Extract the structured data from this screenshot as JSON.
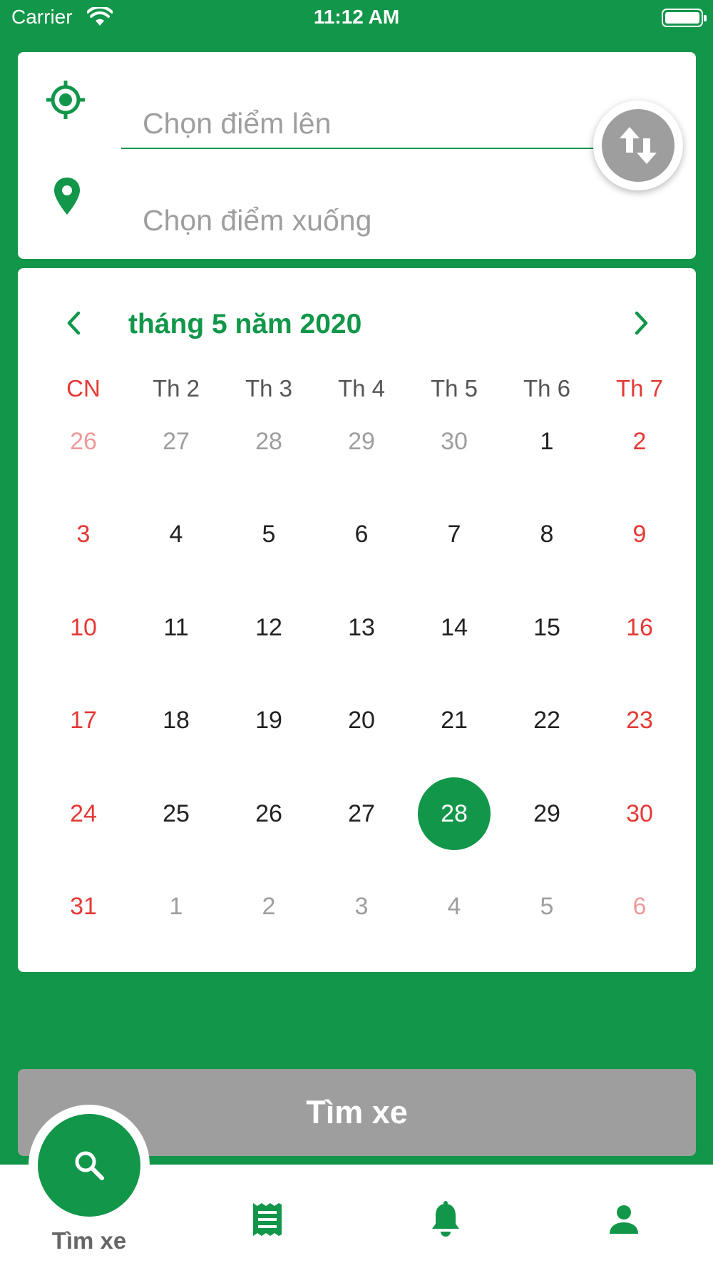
{
  "status_bar": {
    "carrier": "Carrier",
    "time": "11:12 AM"
  },
  "location": {
    "pickup_placeholder": "Chọn điểm lên",
    "dropoff_placeholder": "Chọn điểm xuống"
  },
  "calendar": {
    "month_title": "tháng 5 năm 2020",
    "weekdays": [
      "CN",
      "Th 2",
      "Th 3",
      "Th 4",
      "Th 5",
      "Th 6",
      "Th 7"
    ],
    "days": [
      {
        "label": "26",
        "type": "other"
      },
      {
        "label": "27",
        "type": "other"
      },
      {
        "label": "28",
        "type": "other"
      },
      {
        "label": "29",
        "type": "other"
      },
      {
        "label": "30",
        "type": "other"
      },
      {
        "label": "1",
        "type": "current"
      },
      {
        "label": "2",
        "type": "current"
      },
      {
        "label": "3",
        "type": "current"
      },
      {
        "label": "4",
        "type": "current"
      },
      {
        "label": "5",
        "type": "current"
      },
      {
        "label": "6",
        "type": "current"
      },
      {
        "label": "7",
        "type": "current"
      },
      {
        "label": "8",
        "type": "current"
      },
      {
        "label": "9",
        "type": "current"
      },
      {
        "label": "10",
        "type": "current"
      },
      {
        "label": "11",
        "type": "current"
      },
      {
        "label": "12",
        "type": "current"
      },
      {
        "label": "13",
        "type": "current"
      },
      {
        "label": "14",
        "type": "current"
      },
      {
        "label": "15",
        "type": "current"
      },
      {
        "label": "16",
        "type": "current"
      },
      {
        "label": "17",
        "type": "current"
      },
      {
        "label": "18",
        "type": "current"
      },
      {
        "label": "19",
        "type": "current"
      },
      {
        "label": "20",
        "type": "current"
      },
      {
        "label": "21",
        "type": "current"
      },
      {
        "label": "22",
        "type": "current"
      },
      {
        "label": "23",
        "type": "current"
      },
      {
        "label": "24",
        "type": "current"
      },
      {
        "label": "25",
        "type": "current"
      },
      {
        "label": "26",
        "type": "current"
      },
      {
        "label": "27",
        "type": "current"
      },
      {
        "label": "28",
        "type": "current",
        "selected": true
      },
      {
        "label": "29",
        "type": "current"
      },
      {
        "label": "30",
        "type": "current"
      },
      {
        "label": "31",
        "type": "current"
      },
      {
        "label": "1",
        "type": "other"
      },
      {
        "label": "2",
        "type": "other"
      },
      {
        "label": "3",
        "type": "other"
      },
      {
        "label": "4",
        "type": "other"
      },
      {
        "label": "5",
        "type": "other"
      },
      {
        "label": "6",
        "type": "other"
      }
    ]
  },
  "search_button": {
    "label": "Tìm xe"
  },
  "tab_bar": {
    "tabs": [
      {
        "label": "Tìm xe",
        "icon": "search-icon",
        "active": true
      },
      {
        "label": "",
        "icon": "ticket-icon"
      },
      {
        "label": "",
        "icon": "bell-icon"
      },
      {
        "label": "",
        "icon": "person-icon"
      }
    ]
  },
  "colors": {
    "primary": "#12964a",
    "weekend": "#e53935",
    "disabled": "#9e9e9e"
  }
}
